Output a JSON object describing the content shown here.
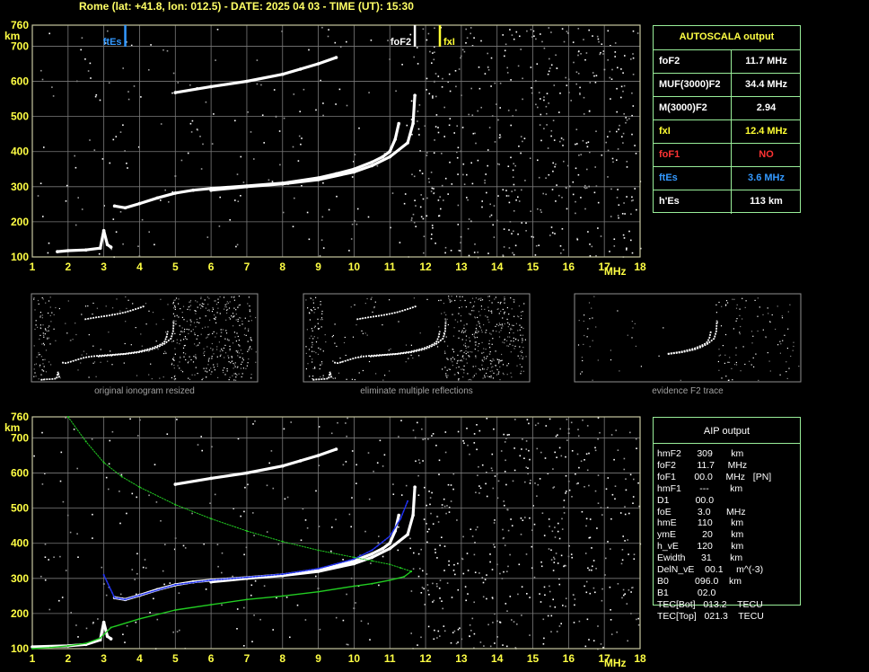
{
  "header": "Rome (lat: +41.8, lon: 012.5) - DATE: 2025 04 03 - TIME (UT): 15:30",
  "colors": {
    "grid": "#7a7a7a",
    "frame": "#c8c8a0",
    "label_yellow": "#ffff44",
    "fxI": "#ffff33",
    "foF1": "#ff3333",
    "ftEs": "#3399ff",
    "green": "#22cc22",
    "blue": "#2233ee",
    "panel_border": "#99ee99"
  },
  "chart_data": [
    {
      "type": "scatter",
      "title": "",
      "xlabel": "MHz",
      "ylabel": "km",
      "xlim": [
        1,
        18
      ],
      "ylim": [
        100,
        760
      ],
      "x_ticks": [
        "1",
        "2",
        "3",
        "4",
        "5",
        "6",
        "7",
        "8",
        "9",
        "10",
        "11",
        "12",
        "13",
        "14",
        "15",
        "16",
        "17",
        "18"
      ],
      "y_ticks": [
        "100",
        "200",
        "300",
        "400",
        "500",
        "600",
        "700",
        "760"
      ],
      "markers": [
        {
          "label": "ftEs",
          "x": 3.6,
          "color": "ftEs"
        },
        {
          "label": "foF2",
          "x": 11.7,
          "color": "white"
        },
        {
          "label": "fxI",
          "x": 12.4,
          "color": "fxI"
        }
      ],
      "series": [
        {
          "x": [
            3.3,
            3.6,
            4.0,
            4.5,
            5.0,
            5.5,
            6.0,
            7.0,
            8.0,
            9.0,
            9.5,
            10.0,
            10.5,
            10.8,
            11.0,
            11.15,
            11.25
          ],
          "y": [
            245,
            240,
            252,
            268,
            282,
            290,
            295,
            302,
            310,
            325,
            337,
            350,
            370,
            385,
            400,
            435,
            480
          ]
        },
        {
          "x": [
            6.0,
            7.0,
            8.0,
            9.0,
            10.0,
            10.5,
            11.0,
            11.5,
            11.65,
            11.7
          ],
          "y": [
            290,
            300,
            308,
            320,
            342,
            360,
            385,
            425,
            480,
            560
          ]
        },
        {
          "x": [
            5.0,
            6.0,
            7.0,
            8.0,
            8.5,
            9.0,
            9.5
          ],
          "y": [
            568,
            585,
            600,
            620,
            635,
            650,
            668
          ]
        },
        {
          "x": [
            1.7,
            2.0,
            2.5,
            2.9,
            3.0,
            3.1,
            3.2
          ],
          "y": [
            115,
            118,
            120,
            125,
            175,
            135,
            128
          ]
        }
      ]
    },
    {
      "type": "scatter",
      "title": "",
      "xlabel": "MHz",
      "ylabel": "km",
      "xlim": [
        1,
        18
      ],
      "ylim": [
        100,
        760
      ],
      "x_ticks": [
        "1",
        "2",
        "3",
        "4",
        "5",
        "6",
        "7",
        "8",
        "9",
        "10",
        "11",
        "12",
        "13",
        "14",
        "15",
        "16",
        "17",
        "18"
      ],
      "y_ticks": [
        "100",
        "200",
        "300",
        "400",
        "500",
        "600",
        "700",
        "760"
      ],
      "series": [
        {
          "x": [
            3.3,
            3.6,
            4.0,
            4.5,
            5.0,
            5.5,
            6.0,
            7.0,
            8.0,
            9.0,
            9.5,
            10.0,
            10.5,
            10.8,
            11.0,
            11.15,
            11.25
          ],
          "y": [
            245,
            240,
            252,
            268,
            282,
            290,
            295,
            302,
            310,
            325,
            337,
            350,
            370,
            385,
            400,
            435,
            480
          ]
        },
        {
          "x": [
            6.0,
            7.0,
            8.0,
            9.0,
            10.0,
            10.5,
            11.0,
            11.5,
            11.65,
            11.7
          ],
          "y": [
            290,
            300,
            308,
            320,
            342,
            360,
            385,
            425,
            480,
            560
          ]
        },
        {
          "x": [
            5.0,
            6.0,
            7.0,
            8.0,
            8.5,
            9.0,
            9.5
          ],
          "y": [
            568,
            585,
            600,
            620,
            635,
            650,
            668
          ]
        },
        {
          "x": [
            1.0,
            2.0,
            2.5,
            2.9,
            3.0,
            3.1,
            3.2
          ],
          "y": [
            105,
            108,
            112,
            125,
            175,
            135,
            128
          ]
        },
        {
          "name": "blue",
          "x": [
            3.0,
            3.3,
            3.6,
            4.0,
            5.0,
            6.0,
            7.0,
            8.0,
            9.0,
            10.0,
            10.5,
            11.0,
            11.3,
            11.5
          ],
          "y": [
            310,
            245,
            240,
            252,
            282,
            295,
            303,
            312,
            328,
            355,
            380,
            420,
            470,
            520
          ]
        },
        {
          "name": "green-top",
          "x": [
            2.0,
            2.5,
            3.0,
            3.5,
            4.0,
            5.0,
            6.0,
            7.0,
            8.0,
            9.0,
            10.0,
            10.5,
            11.0,
            11.3,
            11.6
          ],
          "y": [
            760,
            690,
            630,
            590,
            560,
            510,
            470,
            435,
            405,
            380,
            360,
            350,
            340,
            330,
            320
          ]
        },
        {
          "name": "green-bottom",
          "x": [
            1.0,
            1.5,
            2.0,
            2.5,
            2.9,
            3.2,
            4.0,
            5.0,
            6.0,
            7.0,
            8.0,
            9.0,
            10.0,
            10.5,
            11.0,
            11.4,
            11.6
          ],
          "y": [
            100,
            103,
            108,
            115,
            130,
            160,
            185,
            210,
            225,
            240,
            250,
            262,
            278,
            285,
            295,
            305,
            320
          ]
        }
      ]
    }
  ],
  "autoscala": {
    "title": "AUTOSCALA output",
    "rows": [
      {
        "key": "foF2",
        "value": "11.7 MHz",
        "color": "#ffffff"
      },
      {
        "key": "MUF(3000)F2",
        "value": "34.4 MHz",
        "color": "#ffffff"
      },
      {
        "key": "M(3000)F2",
        "value": "2.94",
        "color": "#ffffff"
      },
      {
        "key": "fxI",
        "value": "12.4 MHz",
        "color": "#ffff33"
      },
      {
        "key": "foF1",
        "value": "NO",
        "color": "#ff3333"
      },
      {
        "key": "ftEs",
        "value": "3.6 MHz",
        "color": "#3399ff"
      },
      {
        "key": "h'Es",
        "value": "113     km",
        "color": "#ffffff"
      }
    ]
  },
  "aip": {
    "title": "AIP output",
    "lines": [
      "hmF2      309       km",
      "foF2        11.7     MHz",
      "foF1       00.0     MHz   [PN]",
      "hmF1       ---        km",
      "D1          00.0",
      "foE          3.0      MHz",
      "hmE        110       km",
      "ymE          20       km",
      "h_vE       120       km",
      "Ewidth      31       km",
      "DelN_vE    00.1     m^(-3)",
      "B0          096.0    km",
      "B1           02.0",
      "TEC[Bot]   013.2    TECU",
      "TEC[Top]   021.3    TECU"
    ]
  },
  "thumbs": [
    {
      "caption": "original ionogram resized"
    },
    {
      "caption": "eliminate multiple reflections"
    },
    {
      "caption": "evidence F2 trace"
    }
  ]
}
